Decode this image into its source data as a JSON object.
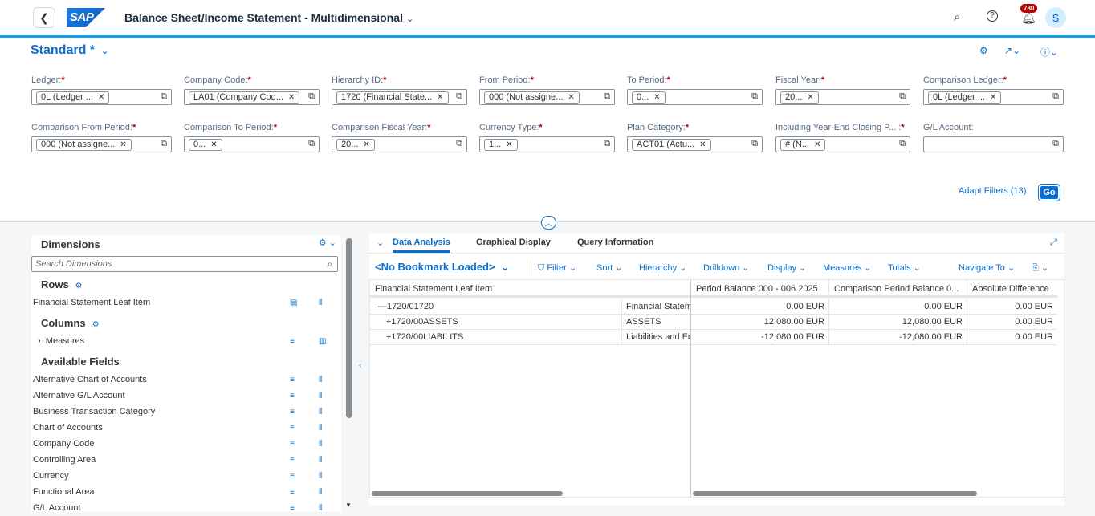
{
  "shell": {
    "title": "Balance Sheet/Income Statement - Multidimensional",
    "logo_text": "SAP",
    "notification_count": "780",
    "avatar_initial": "S",
    "icons": [
      "back-icon",
      "search-icon",
      "help-icon",
      "bell-icon"
    ]
  },
  "filterbar": {
    "variant_name": "Standard *",
    "adapt_filters": "Adapt Filters (13)",
    "go_label": "Go",
    "filters": [
      {
        "label": "Ledger:",
        "token": "0L (Ledger ..."
      },
      {
        "label": "Company Code:",
        "token": "LA01 (Company Cod..."
      },
      {
        "label": "Hierarchy ID:",
        "token": "1720 (Financial State..."
      },
      {
        "label": "From Period:",
        "token": "000 (Not assigne..."
      },
      {
        "label": "To Period:",
        "token": "0..."
      },
      {
        "label": "Fiscal Year:",
        "token": "20..."
      },
      {
        "label": "Comparison Ledger:",
        "token": "0L (Ledger ..."
      },
      {
        "label": "Comparison From Period:",
        "token": "000 (Not assigne..."
      },
      {
        "label": "Comparison To Period:",
        "token": "0..."
      },
      {
        "label": "Comparison Fiscal Year:",
        "token": "20..."
      },
      {
        "label": "Currency Type:",
        "token": "1..."
      },
      {
        "label": "Plan Category:",
        "token": "ACT01 (Actu..."
      },
      {
        "label": "Including Year-End Closing P... :",
        "token": "# (N..."
      },
      {
        "label": "G/L Account:",
        "token": ""
      }
    ]
  },
  "dimensions": {
    "title": "Dimensions",
    "search_placeholder": "Search Dimensions",
    "rows_title": "Rows",
    "rows_items": [
      "Financial Statement Leaf Item"
    ],
    "columns_title": "Columns",
    "columns_items": [
      "Measures"
    ],
    "available_title": "Available Fields",
    "available_items": [
      "Alternative Chart of Accounts",
      "Alternative G/L Account",
      "Business Transaction Category",
      "Chart of Accounts",
      "Company Code",
      "Controlling Area",
      "Currency",
      "Functional Area",
      "G/L Account"
    ]
  },
  "main": {
    "tabs": [
      "Data Analysis",
      "Graphical Display",
      "Query Information"
    ],
    "bookmark": "<No Bookmark Loaded>",
    "toolbar": [
      "Filter",
      "Sort",
      "Hierarchy",
      "Drilldown",
      "Display",
      "Measures",
      "Totals",
      "Navigate To"
    ],
    "grid": {
      "headers": [
        "Financial Statement Leaf Item",
        "Period Balance 000 - 006.2025",
        "Comparison Period Balance 0...",
        "Absolute Difference"
      ],
      "rows": [
        {
          "key": "—1720/01720",
          "text": "Financial Statem",
          "v1": "0.00 EUR",
          "v2": "0.00 EUR",
          "v3": "0.00 EUR"
        },
        {
          "key": "+1720/00ASSETS",
          "text": "ASSETS",
          "v1": "12,080.00 EUR",
          "v2": "12,080.00 EUR",
          "v3": "0.00 EUR"
        },
        {
          "key": "+1720/00LIABILITS",
          "text": "Liabilities and Ec",
          "v1": "-12,080.00 EUR",
          "v2": "-12,080.00 EUR",
          "v3": "0.00 EUR"
        }
      ]
    }
  }
}
